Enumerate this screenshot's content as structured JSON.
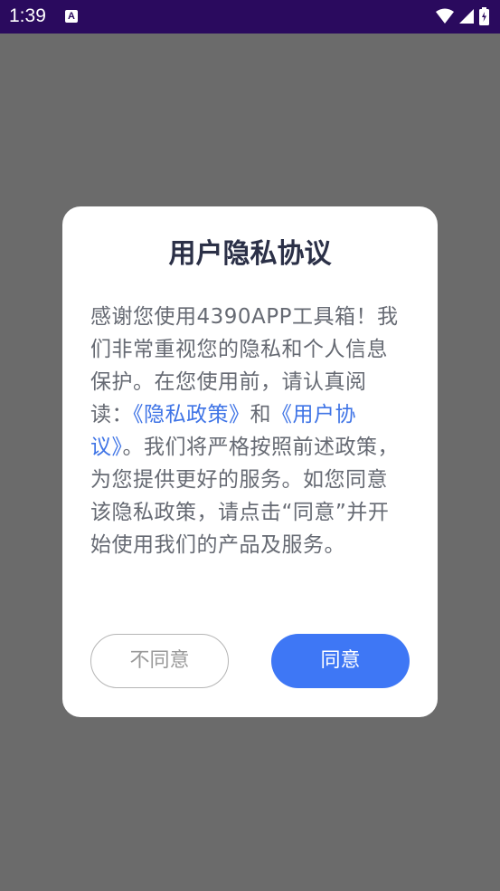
{
  "status_bar": {
    "time": "1:39",
    "notification_icon_letter": "A",
    "icons": [
      "wifi-icon",
      "signal-icon",
      "battery-icon"
    ]
  },
  "dialog": {
    "title": "用户隐私协议",
    "body_part1": "感谢您使用4390APP工具箱！我们非常重视您的隐私和个人信息保护。在您使用前，请认真阅读：",
    "privacy_policy_link": "《隐私政策》",
    "and_text": "和",
    "user_agreement_link": "《用户协议》",
    "body_part2": "。我们将严格按照前述政策，为您提供更好的服务。如您同意该隐私政策，请点击“同意”并开始使用我们的产品及服务。",
    "disagree_label": "不同意",
    "agree_label": "同意"
  },
  "colors": {
    "status_bar": "#2a0a5e",
    "overlay": "#6b6b6b",
    "accent": "#3e77f5",
    "link": "#3f74e6"
  }
}
